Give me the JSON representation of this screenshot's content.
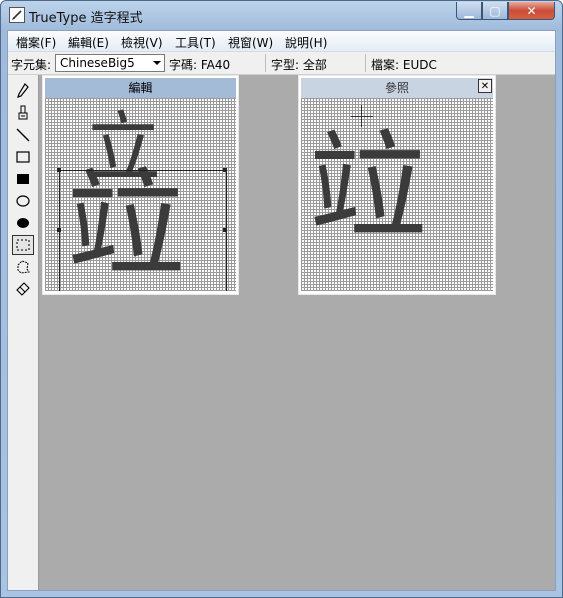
{
  "window": {
    "title": "TrueType 造字程式"
  },
  "window_controls": {
    "minimize": "▁",
    "maximize": "▢",
    "close": "✕"
  },
  "menu": [
    {
      "label": "檔案(F)"
    },
    {
      "label": "編輯(E)"
    },
    {
      "label": "檢視(V)"
    },
    {
      "label": "工具(T)"
    },
    {
      "label": "視窗(W)"
    },
    {
      "label": "說明(H)"
    }
  ],
  "toolbar": {
    "charset_label": "字元集:",
    "charset_value": "ChineseBig5",
    "code_text": "字碼: FA40",
    "font_text": "字型: 全部",
    "file_text": "檔案: EUDC"
  },
  "tools": [
    {
      "icon": "pencil-icon"
    },
    {
      "icon": "brush-icon"
    },
    {
      "icon": "line-icon"
    },
    {
      "icon": "hollow-rectangle-icon"
    },
    {
      "icon": "filled-rectangle-icon"
    },
    {
      "icon": "hollow-ellipse-icon"
    },
    {
      "icon": "filled-ellipse-icon"
    },
    {
      "icon": "rectangular-selection-icon",
      "selected": true
    },
    {
      "icon": "freeform-selection-icon"
    },
    {
      "icon": "eraser-icon"
    }
  ],
  "edit_grid": {
    "title": "編輯",
    "glyph_top": "立",
    "glyph_bottom": "竝"
  },
  "reference_grid": {
    "title": "參照",
    "close_label": "✕",
    "glyph": "竝"
  }
}
